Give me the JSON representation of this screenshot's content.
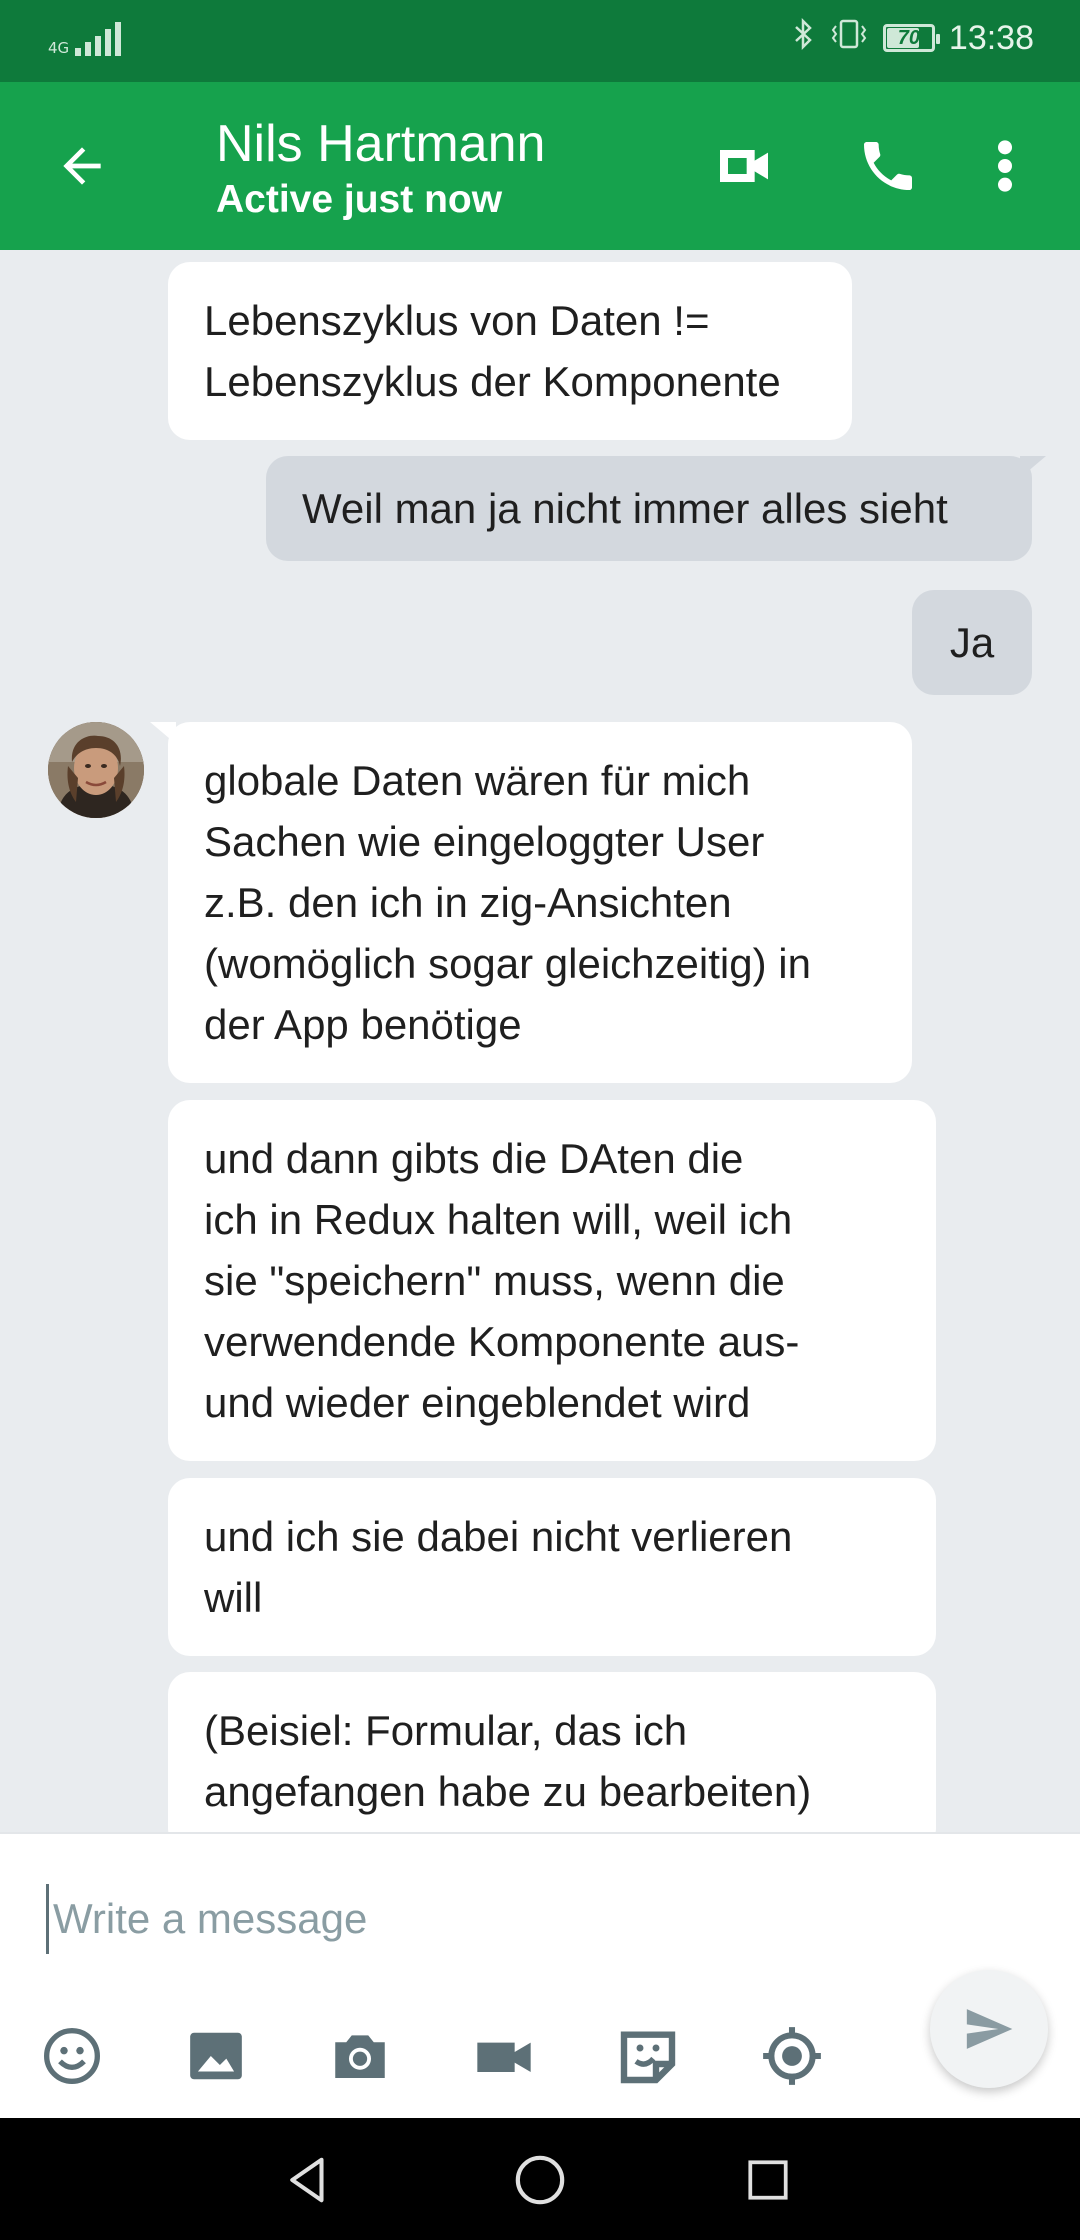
{
  "status_bar": {
    "network": "4G",
    "battery": "70",
    "time": "13:38",
    "text_color": "#cfe8d8"
  },
  "app_bar": {
    "contact_name": "Nils Hartmann",
    "contact_status": "Active just now",
    "color": "#16a24d",
    "icons": [
      "back-arrow-icon",
      "video-call-icon",
      "phone-icon",
      "more-vert-icon"
    ]
  },
  "messages": [
    {
      "direction": "in",
      "text": "Lebenszyklus von Daten !=\nLebenszyklus der Komponente"
    },
    {
      "direction": "out",
      "text": "Weil man ja nicht immer alles sieht"
    },
    {
      "direction": "out",
      "text": "Ja"
    },
    {
      "direction": "in",
      "text": "globale Daten wären für mich\nSachen wie eingeloggter User\nz.B. den ich in zig-Ansichten\n(womöglich sogar gleichzeitig) in\nder App benötige"
    },
    {
      "direction": "in",
      "text": "und dann gibts die DAten die\nich in Redux halten will, weil ich\nsie \"speichern\" muss, wenn die\nverwendende Komponente aus-\nund wieder eingeblendet wird"
    },
    {
      "direction": "in",
      "text": "und ich sie dabei nicht verlieren\nwill"
    },
    {
      "direction": "in",
      "text": "(Beisiel: Formular, das ich\nangefangen habe zu bearbeiten)"
    }
  ],
  "composer": {
    "placeholder": "Write a message",
    "value": "",
    "tools": [
      "emoji-icon",
      "image-icon",
      "camera-icon",
      "video-icon",
      "sticker-icon",
      "location-icon"
    ],
    "send_icon": "send-icon"
  },
  "nav_bar": {
    "icons": [
      "nav-back-icon",
      "nav-home-icon",
      "nav-recents-icon"
    ]
  },
  "colors": {
    "status_bar": "#0e7a3b",
    "app_bar": "#16a24d",
    "chat_background": "#e9ecef",
    "incoming_bubble": "#ffffff",
    "outgoing_bubble": "#d3d8de",
    "composer_icons": "#5d7077"
  }
}
